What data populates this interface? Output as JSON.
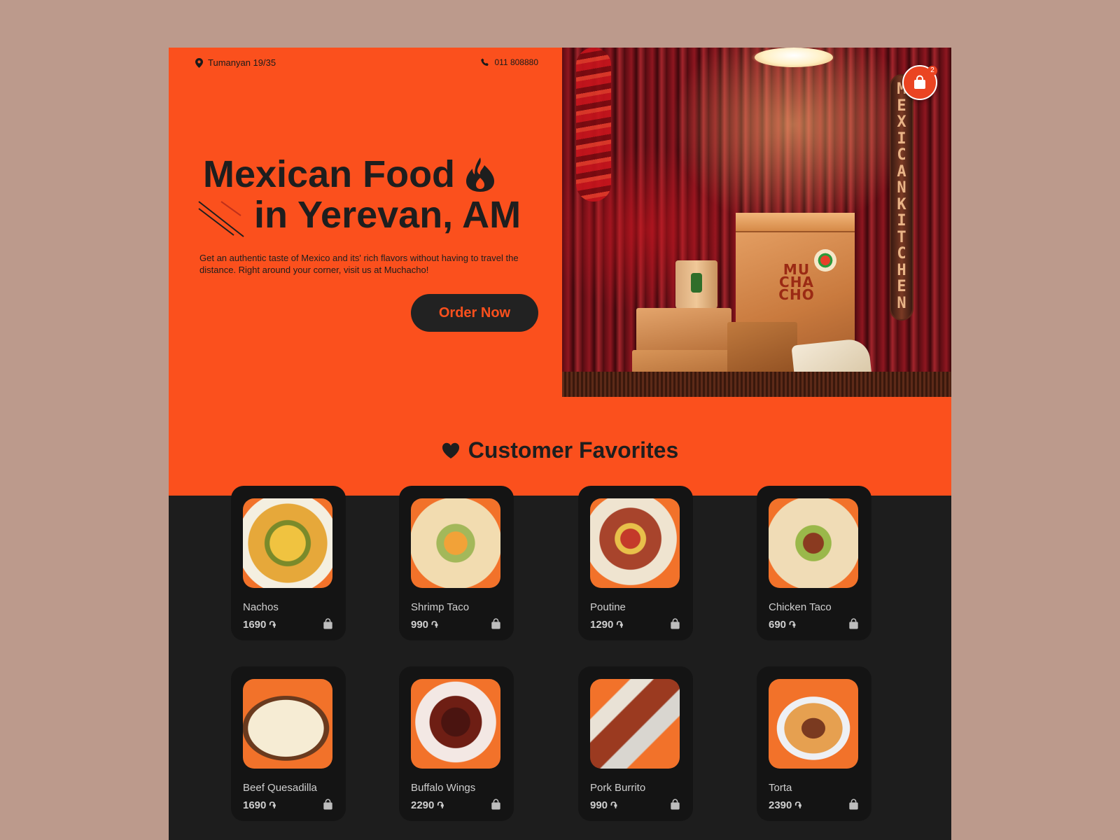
{
  "header": {
    "address": "Tumanyan 19/35",
    "phone": "011 808880",
    "cart_count": "2"
  },
  "hero": {
    "title_line1": "Mexican Food",
    "title_line2": "in Yerevan, AM",
    "description": "Get an authentic taste of Mexico and its' rich flavors without having to travel the distance. Right around your corner, visit us at Muchacho!",
    "cta_label": "Order Now",
    "image": {
      "sign_text": "MEXICAN KITCHEN",
      "bag_logo": "MU CHA CHO"
    }
  },
  "favorites": {
    "title": "Customer Favorites",
    "currency_symbol": "֏",
    "items": [
      {
        "name": "Nachos",
        "price": "1690"
      },
      {
        "name": "Shrimp Taco",
        "price": "990"
      },
      {
        "name": "Poutine",
        "price": "1290"
      },
      {
        "name": "Chicken Taco",
        "price": "690"
      },
      {
        "name": "Beef Quesadilla",
        "price": "1690"
      },
      {
        "name": "Buffalo Wings",
        "price": "2290"
      },
      {
        "name": "Pork Burrito",
        "price": "990"
      },
      {
        "name": "Torta",
        "price": "2390"
      }
    ]
  },
  "colors": {
    "accent": "#fb501d",
    "dark": "#1d1d1d",
    "card": "#141414",
    "page_bg": "#bc9a8c"
  },
  "icons": [
    "location-pin-icon",
    "phone-icon",
    "flame-icon",
    "heart-icon",
    "shopping-bag-icon",
    "dram-currency-icon"
  ]
}
